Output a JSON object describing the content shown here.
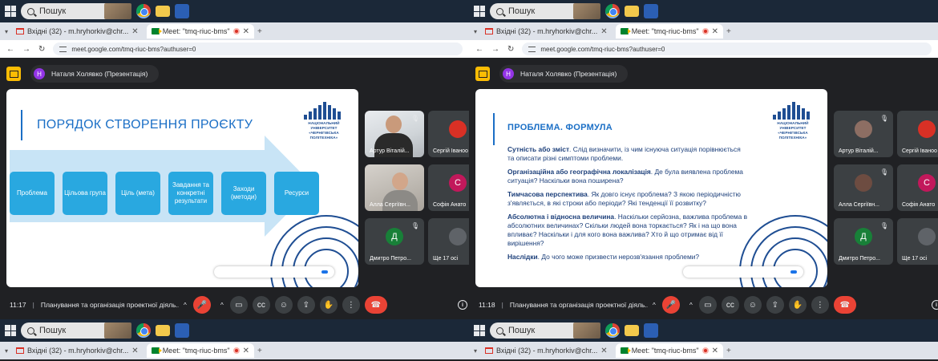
{
  "taskbar": {
    "search_placeholder": "Пошук"
  },
  "browser": {
    "tabs": [
      {
        "label": "Вхідні (32) - m.hryhorkiv@chr..."
      },
      {
        "label": "Meet: \"tmq-riuc-bms\""
      }
    ],
    "url": "meet.google.com/tmq-riuc-bms?authuser=0"
  },
  "meet": {
    "presenter_initial": "Н",
    "presenter_label": "Наталя Холявко (Презентація)",
    "meeting_title": "Планування та організація проектної діяль...",
    "accent_color": "#1b6fc6",
    "hangup_color": "#ea4335"
  },
  "left_panel": {
    "time": "11:17",
    "slide": {
      "title": "ПОРЯДОК СТВОРЕННЯ ПРОЄКТУ",
      "steps": [
        "Проблема",
        "Цільова група",
        "Ціль (мета)",
        "Завдання та конкретні результати",
        "Заходи (методи)",
        "Ресурси"
      ]
    },
    "participants": [
      {
        "name": "Артур Віталій...",
        "type": "camera"
      },
      {
        "name": "Сергій Іваноо",
        "initial": "",
        "color": "#d93025"
      },
      {
        "name": "Алла Сергіївн...",
        "type": "camera"
      },
      {
        "name": "Софія Анато",
        "initial": "С",
        "color": "#c2185b"
      },
      {
        "name": "Дмитро Петро...",
        "initial": "Д",
        "color": "#188038"
      },
      {
        "name": "Ще 17 осі",
        "initial": "",
        "color": "#5f6368"
      }
    ]
  },
  "right_panel": {
    "time": "11:18",
    "slide": {
      "title": "ПРОБЛЕМА. ФОРМУЛА",
      "items": [
        {
          "term": "Сутність або зміст",
          "text": ". Слід визначити, із чим існуюча ситуація порівнюється та описати різні симптоми проблеми."
        },
        {
          "term": "Організаційна або географічна локалізація",
          "text": ". Де була виявлена проблема ситуація? Наскільки вона поширена?"
        },
        {
          "term": "Тимчасова перспектива",
          "text": ". Як довго існує проблема? З якою періодичністю з'являється, в які строки або періоди? Які тенденції її розвитку?"
        },
        {
          "term": "Абсолютна і відносна величина",
          "text": ". Наскільки серйозна, важлива проблема в абсолютних величинах? Скільки людей вона торкається? Як і на що вона впливає? Наскільки і для кого вона важлива? Хто й що отримає від її вирішення?"
        },
        {
          "term": "Наслідки",
          "text": ". До чого може призвести нерозв'язання проблеми?"
        }
      ]
    },
    "participants": [
      {
        "name": "Артур Віталій...",
        "initial": "",
        "color": "#8d6e63"
      },
      {
        "name": "Сергій Іваноо",
        "initial": "",
        "color": "#d93025"
      },
      {
        "name": "Алла Сергіївн...",
        "initial": "",
        "color": "#6d4c41"
      },
      {
        "name": "Софія Анато",
        "initial": "С",
        "color": "#c2185b"
      },
      {
        "name": "Дмитро Петро...",
        "initial": "Д",
        "color": "#188038"
      },
      {
        "name": "Ще 17 осі",
        "initial": "",
        "color": "#5f6368"
      }
    ]
  }
}
